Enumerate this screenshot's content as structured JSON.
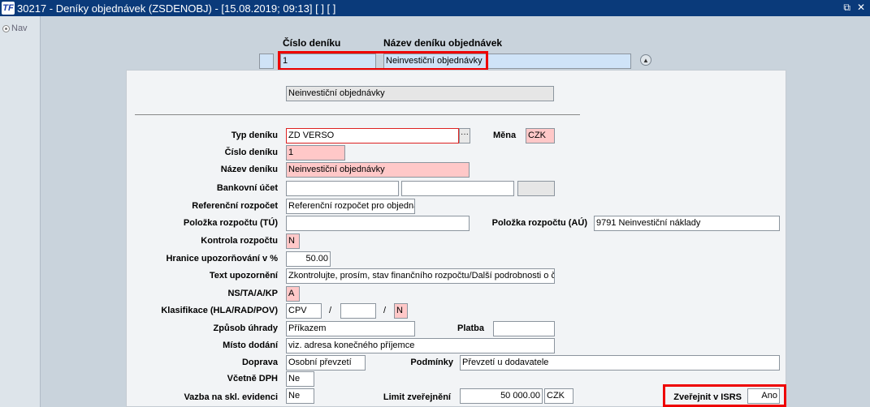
{
  "window": {
    "title": "30217 - Deníky objednávek (ZSDENOBJ) - [15.08.2019; 09:13]  [ ]  [ ]",
    "logo_text": "TF",
    "restore_icon": "restore-window-icon",
    "close_icon": "close-icon"
  },
  "sidebar": {
    "nav_label": "Nav"
  },
  "list_header": {
    "col_number": "Číslo deníku",
    "col_name": "Název deníku objednávek"
  },
  "list_row": {
    "number": "1",
    "name": "Neinvestiční objednávky"
  },
  "detail": {
    "title_value": "Neinvestiční objednávky",
    "labels": {
      "typ_deniku": "Typ deníku",
      "mena": "Měna",
      "cislo_deniku": "Číslo deníku",
      "nazev_deniku": "Název deníku",
      "bankovni_ucet": "Bankovní účet",
      "referencni_rozpocet": "Referenční rozpočet",
      "polozka_tu": "Položka rozpočtu (TÚ)",
      "polozka_au": "Položka rozpočtu (AÚ)",
      "kontrola_rozpoctu": "Kontrola rozpočtu",
      "hranice": "Hranice upozorňování v %",
      "text_upozorneni": "Text upozornění",
      "ns": "NS/TA/A/KP",
      "klasifikace": "Klasifikace (HLA/RAD/POV)",
      "zpusob_uhrady": "Způsob úhrady",
      "platba": "Platba",
      "misto_dodani": "Místo dodání",
      "doprava": "Doprava",
      "podminky": "Podmínky",
      "vcetne_dph": "Včetně DPH",
      "vazba": "Vazba na skl. evidenci",
      "limit": "Limit zveřejnění",
      "zverejnit": "Zveřejnit v ISRS"
    },
    "values": {
      "typ_deniku": "ZD VERSO",
      "lookup": "···",
      "mena": "CZK",
      "cislo_deniku": "1",
      "nazev_deniku": "Neinvestiční objednávky",
      "bank1": "",
      "bank2": "",
      "bank3": "",
      "referencni_rozpocet": "Referenční rozpočet pro objedná",
      "polozka_tu": "",
      "polozka_au": "9791 Neinvestiční náklady",
      "kontrola_rozpoctu": "N",
      "hranice": "50.00",
      "text_upozorneni": "Zkontrolujte, prosím, stav finančního rozpočtu/Další podrobnosti o če",
      "ns": "A",
      "klas1": "CPV",
      "klas2": "",
      "klas3": "N",
      "slash": "/",
      "zpusob_uhrady": "Příkazem",
      "platba": "",
      "misto_dodani": "viz. adresa konečného příjemce",
      "doprava": "Osobní převzetí",
      "podminky": "Převzetí u dodavatele",
      "vcetne_dph": "Ne",
      "vazba": "Ne",
      "limit": "50 000.00",
      "limit_mena": "CZK",
      "zverejnit": "Ano"
    }
  },
  "colors": {
    "title_bar": "#0a3a7a",
    "highlight": "#e00000",
    "required": "#ffc8c8",
    "row_selected": "#cfe3f7"
  }
}
